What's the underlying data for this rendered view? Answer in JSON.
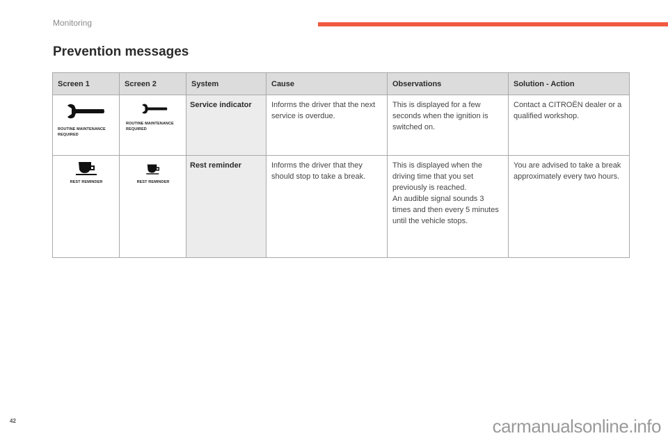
{
  "header": {
    "section": "Monitoring",
    "accent_color": "#f05a40",
    "title": "Prevention messages"
  },
  "table": {
    "columns": [
      "Screen 1",
      "Screen 2",
      "System",
      "Cause",
      "Observations",
      "Solution - Action"
    ],
    "rows": [
      {
        "screen1": {
          "icon": "wrench-icon",
          "caption_line1": "ROUTINE MAINTENANCE",
          "caption_line2": "REQUIRED"
        },
        "screen2": {
          "icon": "wrench-icon",
          "caption_line1": "ROUTINE MAINTENANCE",
          "caption_line2": "REQUIRED"
        },
        "system": "Service indicator",
        "cause": "Informs the driver that the next service is overdue.",
        "observations": [
          "This is displayed for a few seconds when the ignition is switched on."
        ],
        "solution": "Contact a CITROËN dealer or a qualified workshop."
      },
      {
        "screen1": {
          "icon": "coffee-cup-icon",
          "caption_line1": "REST REMINDER"
        },
        "screen2": {
          "icon": "coffee-cup-icon",
          "caption_line1": "REST REMINDER"
        },
        "system": "Rest reminder",
        "cause": "Informs the driver that they should stop to take a break.",
        "observations": [
          "This is displayed when the driving time that you set previously is reached.",
          "An audible signal sounds 3 times and then every 5 minutes until the vehicle stops."
        ],
        "solution": "You are advised to take a break approximately every two hours."
      }
    ]
  },
  "footer": {
    "page_number": "42",
    "watermark": "carmanualsonline.info"
  }
}
